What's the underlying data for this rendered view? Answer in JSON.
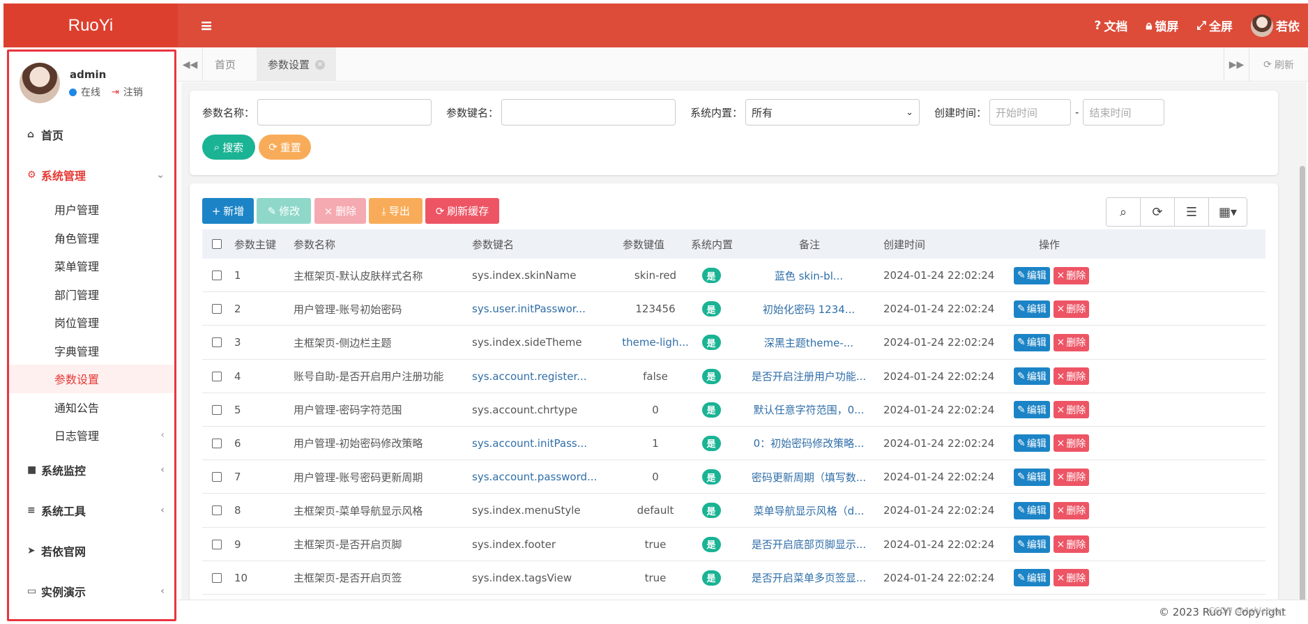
{
  "app": {
    "logo": "RuoYi"
  },
  "user": {
    "name": "admin",
    "status": "在线",
    "logout": "注销"
  },
  "sidebar": {
    "home": "首页",
    "system": "系统管理",
    "sub": [
      "用户管理",
      "角色管理",
      "菜单管理",
      "部门管理",
      "岗位管理",
      "字典管理",
      "参数设置",
      "通知公告",
      "日志管理"
    ],
    "monitor": "系统监控",
    "tools": "系统工具",
    "site": "若依官网",
    "demo": "实例演示"
  },
  "topbar": {
    "docs": "文档",
    "lock": "锁屏",
    "fullscreen": "全屏",
    "user": "若依"
  },
  "tabs": {
    "home": "首页",
    "current": "参数设置",
    "refresh": "刷新"
  },
  "search": {
    "param_name_label": "参数名称：",
    "param_key_label": "参数键名：",
    "builtin_label": "系统内置：",
    "builtin_value": "所有",
    "created_label": "创建时间：",
    "start_placeholder": "开始时间",
    "end_placeholder": "结束时间",
    "dash": "-",
    "search_btn": "搜索",
    "reset_btn": "重置"
  },
  "toolbar": {
    "add": "新增",
    "edit": "修改",
    "delete": "删除",
    "export": "导出",
    "refresh_cache": "刷新缓存"
  },
  "table": {
    "headers": [
      "参数主键",
      "参数名称",
      "参数键名",
      "参数键值",
      "系统内置",
      "备注",
      "创建时间",
      "操作"
    ],
    "edit_label": "编辑",
    "delete_label": "删除",
    "rows": [
      {
        "id": "1",
        "name": "主框架页-默认皮肤样式名称",
        "key": "sys.index.skinName",
        "key_link": false,
        "value": "skin-red",
        "value_link": false,
        "builtin": "是",
        "remark": "蓝色 skin-bl...",
        "created": "2024-01-24 22:02:24"
      },
      {
        "id": "2",
        "name": "用户管理-账号初始密码",
        "key": "sys.user.initPasswor...",
        "key_link": true,
        "value": "123456",
        "value_link": false,
        "builtin": "是",
        "remark": "初始化密码 1234...",
        "created": "2024-01-24 22:02:24"
      },
      {
        "id": "3",
        "name": "主框架页-侧边栏主题",
        "key": "sys.index.sideTheme",
        "key_link": false,
        "value": "theme-ligh...",
        "value_link": true,
        "builtin": "是",
        "remark": "深黑主题theme-...",
        "created": "2024-01-24 22:02:24"
      },
      {
        "id": "4",
        "name": "账号自助-是否开启用户注册功能",
        "key": "sys.account.register...",
        "key_link": true,
        "value": "false",
        "value_link": false,
        "builtin": "是",
        "remark": "是否开启注册用户功能...",
        "created": "2024-01-24 22:02:24"
      },
      {
        "id": "5",
        "name": "用户管理-密码字符范围",
        "key": "sys.account.chrtype",
        "key_link": false,
        "value": "0",
        "value_link": false,
        "builtin": "是",
        "remark": "默认任意字符范围，0...",
        "created": "2024-01-24 22:02:24"
      },
      {
        "id": "6",
        "name": "用户管理-初始密码修改策略",
        "key": "sys.account.initPass...",
        "key_link": true,
        "value": "1",
        "value_link": false,
        "builtin": "是",
        "remark": "0：初始密码修改策略...",
        "created": "2024-01-24 22:02:24"
      },
      {
        "id": "7",
        "name": "用户管理-账号密码更新周期",
        "key": "sys.account.password...",
        "key_link": true,
        "value": "0",
        "value_link": false,
        "builtin": "是",
        "remark": "密码更新周期（填写数...",
        "created": "2024-01-24 22:02:24"
      },
      {
        "id": "8",
        "name": "主框架页-菜单导航显示风格",
        "key": "sys.index.menuStyle",
        "key_link": false,
        "value": "default",
        "value_link": false,
        "builtin": "是",
        "remark": "菜单导航显示风格（d...",
        "created": "2024-01-24 22:02:24"
      },
      {
        "id": "9",
        "name": "主框架页-是否开启页脚",
        "key": "sys.index.footer",
        "key_link": false,
        "value": "true",
        "value_link": false,
        "builtin": "是",
        "remark": "是否开启底部页脚显示...",
        "created": "2024-01-24 22:02:24"
      },
      {
        "id": "10",
        "name": "主框架页-是否开启页签",
        "key": "sys.index.tagsView",
        "key_link": false,
        "value": "true",
        "value_link": false,
        "builtin": "是",
        "remark": "是否开启菜单多页签显...",
        "created": "2024-01-24 22:02:24"
      }
    ]
  },
  "footer": {
    "copyright": "© 2023 RuoYi Copyright",
    "watermark": "CSDN @Ashleeey_"
  },
  "colors": {
    "brand": "#dd4b39",
    "primary": "#1c84c6",
    "success": "#1ab394",
    "warning": "#f8ac59",
    "danger": "#ed5565"
  }
}
